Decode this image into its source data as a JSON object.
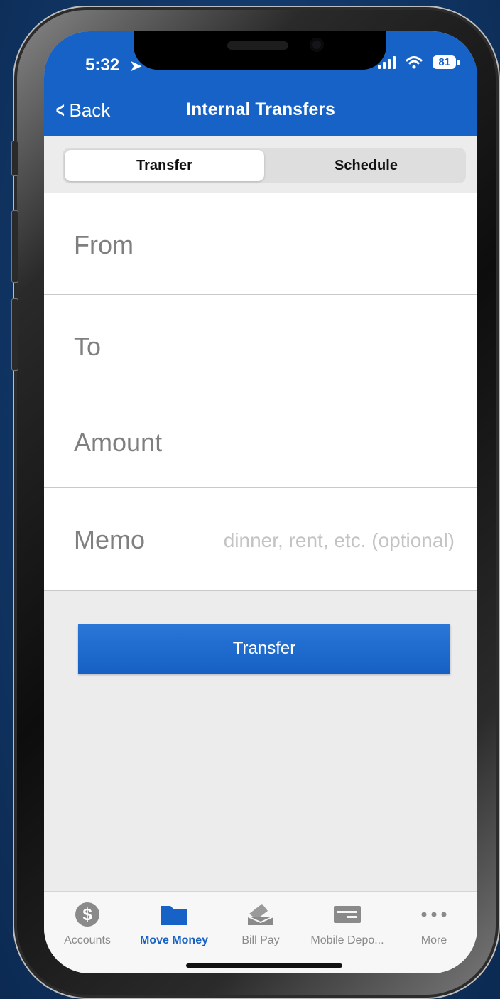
{
  "status_bar": {
    "time": "5:32",
    "battery": "81"
  },
  "nav": {
    "back_label": "Back",
    "title": "Internal Transfers"
  },
  "segments": [
    {
      "label": "Transfer",
      "active": true
    },
    {
      "label": "Schedule",
      "active": false
    }
  ],
  "form": {
    "from_label": "From",
    "to_label": "To",
    "amount_label": "Amount",
    "memo_label": "Memo",
    "memo_placeholder": "dinner, rent, etc. (optional)"
  },
  "transfer_button": "Transfer",
  "tabs": [
    {
      "label": "Accounts",
      "icon": "dollar-circle-icon",
      "active": false
    },
    {
      "label": "Move Money",
      "icon": "folder-icon",
      "active": true
    },
    {
      "label": "Bill Pay",
      "icon": "bill-envelope-icon",
      "active": false
    },
    {
      "label": "Mobile Depo...",
      "icon": "check-card-icon",
      "active": false
    },
    {
      "label": "More",
      "icon": "ellipsis-icon",
      "active": false
    }
  ],
  "colors": {
    "accent": "#1762c7",
    "background": "#ececec",
    "inactive_tab": "#8a8a8a"
  }
}
